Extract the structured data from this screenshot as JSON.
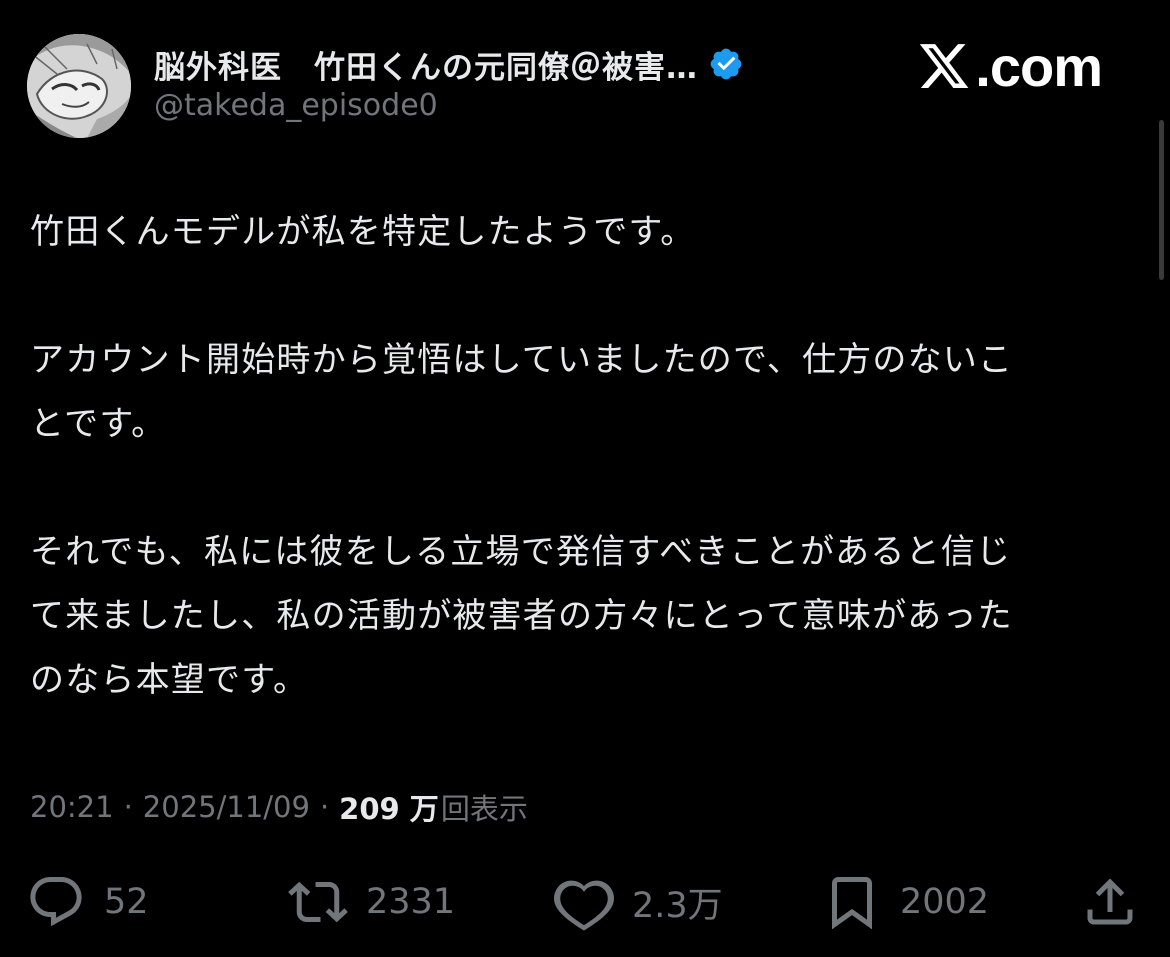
{
  "author": {
    "display_name": "脳外科医　竹田くんの元同僚＠被害…",
    "handle": "@takeda_episode0",
    "verified_icon": "verified-badge-icon",
    "avatar_icon": "manga-portrait-avatar"
  },
  "brand": {
    "text": ".com",
    "logo_icon": "x-logo-icon"
  },
  "tweet": {
    "paragraphs": [
      [
        "竹田くんモデルが私を特定したようです。"
      ],
      [
        "アカウント開始時から覚悟はしていましたので、仕方のないこ",
        "とです。"
      ],
      [
        "それでも、私には彼をしる立場で発信すべきことがあると信じ",
        "て来ましたし、私の活動が被害者の方々にとって意味があった",
        "のなら本望です。"
      ]
    ]
  },
  "meta": {
    "time": "20:21",
    "separator": "·",
    "date": "2025/11/09",
    "views_count": "209 万",
    "views_label": "回表示"
  },
  "actions": {
    "reply": {
      "icon": "reply-icon",
      "count": "52"
    },
    "retweet": {
      "icon": "retweet-icon",
      "count": "2331"
    },
    "like": {
      "icon": "heart-icon",
      "count": "2.3万"
    },
    "bookmark": {
      "icon": "bookmark-icon",
      "count": "2002"
    },
    "share": {
      "icon": "share-icon"
    }
  },
  "colors": {
    "background": "#000000",
    "primary_text": "#e7e9ea",
    "secondary_text": "#71767b",
    "verified_blue": "#1d9bf0"
  }
}
